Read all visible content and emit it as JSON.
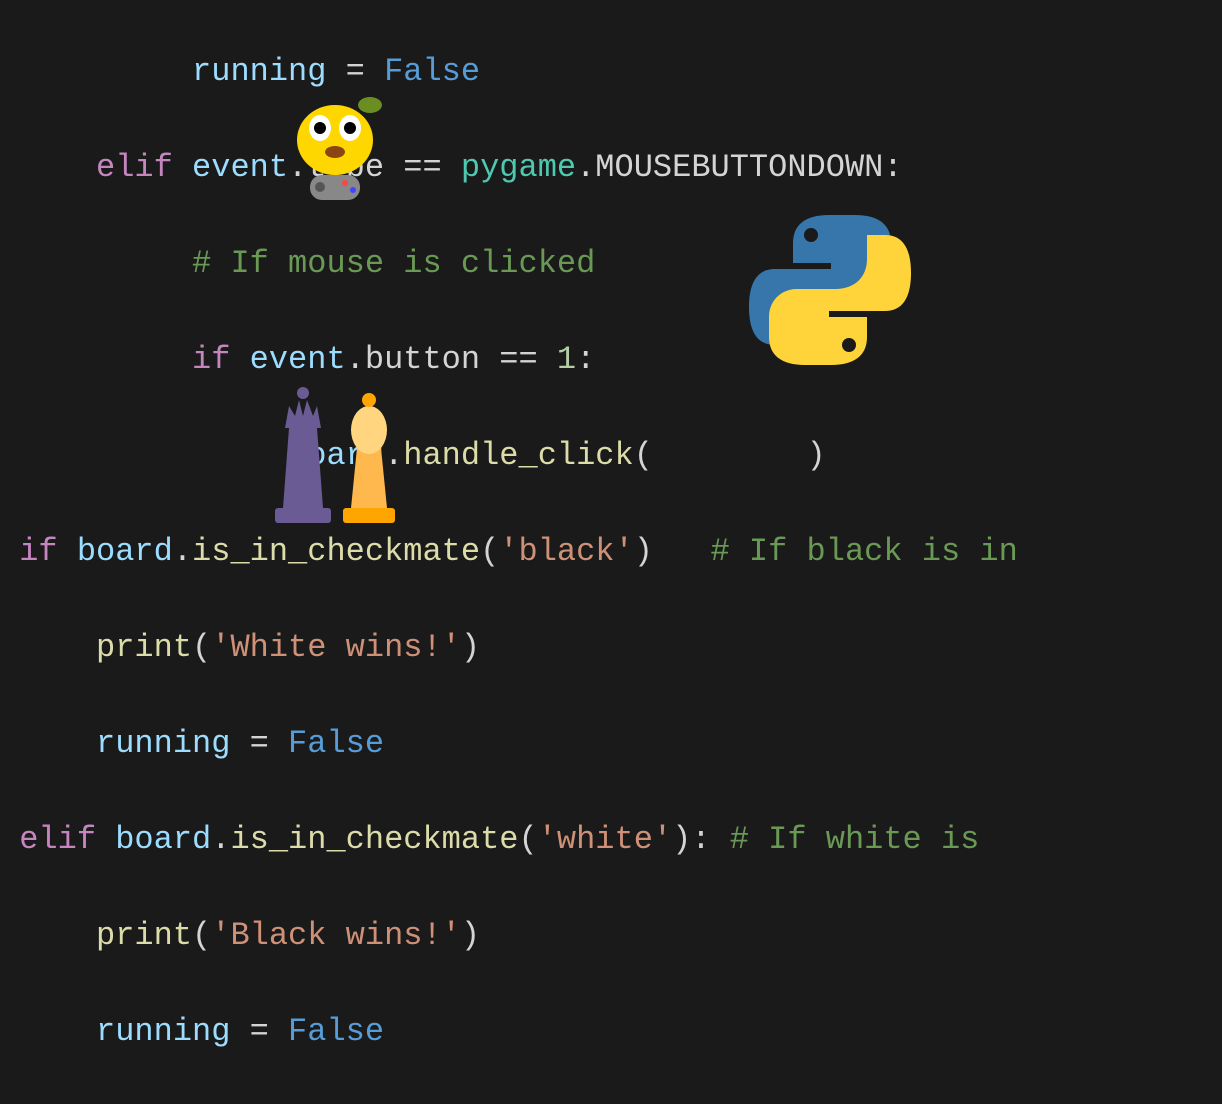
{
  "code": {
    "line1": {
      "text1": "running",
      "text2": " = ",
      "text3": "False"
    },
    "line2": {
      "text1": "elif",
      "text2": " event",
      "text3": ".",
      "text4": "type",
      "text5": " == ",
      "text6": "pygame",
      "text7": ".",
      "text8": "MOUSEBUTTONDOWN",
      "text9": ":"
    },
    "line3": {
      "text1": "# If",
      "text2": " mouse is clicked"
    },
    "line4": {
      "text1": "if",
      "text2": " event",
      "text3": ".",
      "text4": "button",
      "text5": " == ",
      "text6": "1",
      "text7": ":"
    },
    "line5": {
      "text1": "board",
      "text2": ".",
      "text3": "handle_click",
      "text4": "(",
      "text5": ")"
    },
    "line6": {
      "text1": "if",
      "text2": " board",
      "text3": ".",
      "text4": "is_in_checkmate",
      "text5": "(",
      "text6": "'black'",
      "text7": ")",
      "text8": " # If black is in"
    },
    "line7": {
      "text1": "print",
      "text2": "(",
      "text3": "'White wins!'",
      "text4": ")"
    },
    "line8": {
      "text1": "running",
      "text2": " = ",
      "text3": "False"
    },
    "line9": {
      "text1": "elif",
      "text2": " board",
      "text3": ".",
      "text4": "is_in_checkmate",
      "text5": "(",
      "text6": "'white'",
      "text7": ")",
      "text8": ": ",
      "text9": "# If white is"
    },
    "line10": {
      "text1": "print",
      "text2": "(",
      "text3": "'Black wins!'",
      "text4": ")"
    },
    "line11": {
      "text1": "running",
      "text2": " = ",
      "text3": "False"
    }
  },
  "icons": {
    "python_logo": "python-logo-icon",
    "pygame_mascot": "pygame-mascot-icon",
    "chess_pieces": "chess-pieces-icon"
  }
}
